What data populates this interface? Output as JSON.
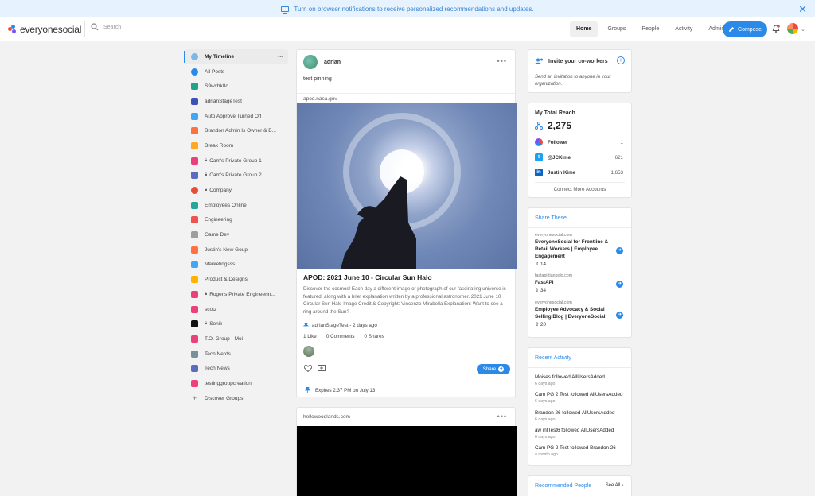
{
  "banner": {
    "text": "Turn on browser notifications to receive personalized recommendations and updates."
  },
  "nav": {
    "logo": "everyonesocial",
    "search_placeholder": "Search",
    "links": [
      "Home",
      "Groups",
      "People",
      "Activity",
      "Admin"
    ],
    "compose": "Compose"
  },
  "sidebar": {
    "items": [
      {
        "label": "My Timeline",
        "color": "#7cb7e6",
        "locked": false
      },
      {
        "label": "All Posts",
        "color": "#2b8ae8",
        "locked": false
      },
      {
        "label": "S9wxbk8c",
        "color": "#1fa38a",
        "locked": false
      },
      {
        "label": "adrianStageTest",
        "color": "#3f51b5",
        "locked": false
      },
      {
        "label": "Auto Approve Turned Off",
        "color": "#42a5f5",
        "locked": false
      },
      {
        "label": "Brandon Admin Is Owner & B...",
        "color": "#ff7043",
        "locked": false
      },
      {
        "label": "Break Room",
        "color": "#ffa726",
        "locked": false
      },
      {
        "label": "Cam's Private Group 1",
        "color": "#ec407a",
        "locked": true
      },
      {
        "label": "Cam's Private Group 2",
        "color": "#5c6bc0",
        "locked": true
      },
      {
        "label": "Company",
        "color": "#e84c3d",
        "locked": true
      },
      {
        "label": "Employees Online",
        "color": "#26a69a",
        "locked": false
      },
      {
        "label": "Engineering",
        "color": "#ef5350",
        "locked": false
      },
      {
        "label": "Game Dev",
        "color": "#9e9e9e",
        "locked": false
      },
      {
        "label": "Justin's New Goup",
        "color": "#ff7043",
        "locked": false
      },
      {
        "label": "Marketingsss",
        "color": "#42a5f5",
        "locked": false
      },
      {
        "label": "Product & Designs",
        "color": "#ffb300",
        "locked": false
      },
      {
        "label": "Roger's Private Engineerin...",
        "color": "#ec407a",
        "locked": true
      },
      {
        "label": "scotz",
        "color": "#ec407a",
        "locked": false
      },
      {
        "label": "Sonik",
        "color": "#111111",
        "locked": true
      },
      {
        "label": "T.O. Group - Moi",
        "color": "#ec407a",
        "locked": false
      },
      {
        "label": "Tech Nerds",
        "color": "#78909c",
        "locked": false
      },
      {
        "label": "Tech News",
        "color": "#5c6bc0",
        "locked": false
      },
      {
        "label": "testinggroupcreation",
        "color": "#ec407a",
        "locked": false
      }
    ],
    "discover": "Discover Groups"
  },
  "post1": {
    "author": "adrian",
    "text": "test pinning",
    "domain": "apod.nasa.gov",
    "title": "APOD: 2021 June 10 - Circular Sun Halo",
    "description": "Discover the cosmos! Each day a different image or photograph of our fascinating universe is featured, along with a brief explanation written by a professional astronomer. 2021 June 10 Circular Sun Halo Image Credit & Copyright: Vincenzo Mirabella Explanation: Want to see a ring around the Sun?",
    "meta": "adrianStageTest - 2 days ago",
    "likes": "1 Like",
    "comments": "0 Comments",
    "shares": "0 Shares",
    "share_btn": "Share",
    "expires": "Expires 2:37 PM on July 13"
  },
  "post2": {
    "domain": "hellowoodlands.com"
  },
  "invite": {
    "title": "Invite your co-workers",
    "text": "Send an invitation to anyone in your organization."
  },
  "reach": {
    "title": "My Total Reach",
    "total": "2,275",
    "accounts": [
      {
        "name": "Follower",
        "value": "1",
        "color": "#e84c3d"
      },
      {
        "name": "@JCKime",
        "value": "621",
        "color": "#1da1f2"
      },
      {
        "name": "Justin Kime",
        "value": "1,653",
        "color": "#0a66c2"
      }
    ],
    "connect": "Connect More Accounts"
  },
  "share_these": {
    "title": "Share These",
    "items": [
      {
        "domain": "everyonesocial.com",
        "title": "EveryoneSocial for Frontline & Retail Workers | Employee Engagement",
        "count": "14"
      },
      {
        "domain": "fastapi.tiangolo.com",
        "title": "FastAPI",
        "count": "34"
      },
      {
        "domain": "everyonesocial.com",
        "title": "Employee Advocacy & Social Selling Blog | EveryoneSocial",
        "count": "20"
      }
    ]
  },
  "recent": {
    "title": "Recent Activity",
    "items": [
      {
        "text": "Moises followed AllUsersAdded",
        "date": "6 days ago"
      },
      {
        "text": "Cam PG 2 Test followed AllUsersAdded",
        "date": "6 days ago"
      },
      {
        "text": "Brandon 26 followed AllUsersAdded",
        "date": "6 days ago"
      },
      {
        "text": "aw intTest6 followed AllUsersAdded",
        "date": "6 days ago"
      },
      {
        "text": "Cam PG 2 Test followed Brandon 26",
        "date": "a month ago"
      }
    ]
  },
  "recommended": {
    "title": "Recommended People",
    "see_all": "See All"
  }
}
